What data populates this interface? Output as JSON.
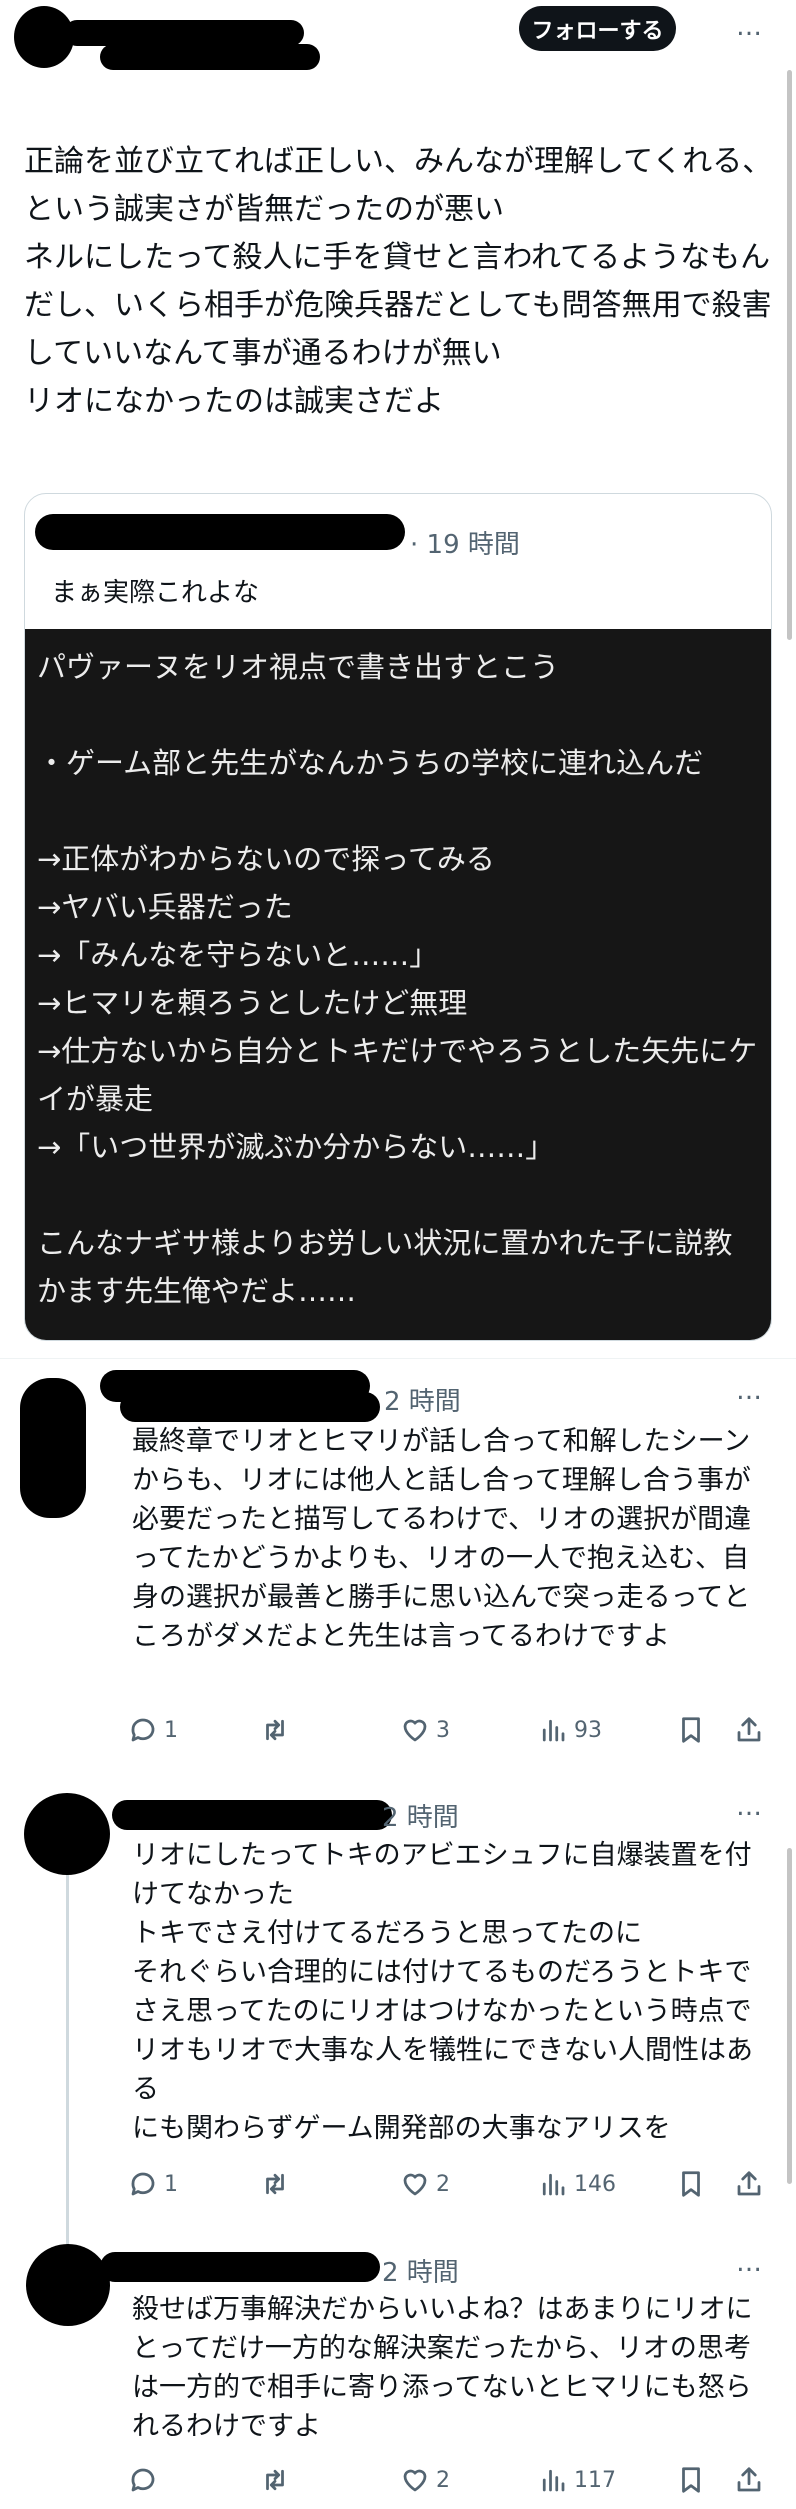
{
  "header": {
    "follow_label": "フォローする",
    "more_icon": "…"
  },
  "main_post": {
    "paragraphs": [
      "正論を並び立てれば正しい、みんなが理解してくれる、という誠実さが皆無だったのが悪い",
      "ネルにしたって殺人に手を貸せと言われてるようなもんだし、いくら相手が危険兵器だとしても問答無用で殺害していいなんて事が通るわけが無い",
      "リオになかったのは誠実さだよ"
    ]
  },
  "quote": {
    "time": "· 19 時間",
    "text": "まぁ実際これよな",
    "image_lines": [
      "パヴァーヌをリオ視点で書き出すとこう",
      "",
      "・ゲーム部と先生がなんかうちの学校に連れ込んだ",
      "→正体がわからないので探ってみる",
      "→ヤバい兵器だった",
      "→「みんなを守らないと……」",
      "→ヒマリを頼ろうとしたけど無理",
      "→仕方ないから自分とトキだけでやろうとした矢先にケイが暴走",
      "→「いつ世界が滅ぶか分からない……」",
      "",
      "こんなナギサ様よりお労しい状況に置かれた子に説教かます先生俺やだよ……"
    ]
  },
  "replies": [
    {
      "time": "2 時間",
      "text": "最終章でリオとヒマリが話し合って和解したシーンからも、リオには他人と話し合って理解し合う事が必要だったと描写してるわけで、リオの選択が間違ってたかどうかよりも、リオの一人で抱え込む、自身の選択が最善と勝手に思い込んで突っ走るってところがダメだよと先生は言ってるわけですよ",
      "replies": "1",
      "reposts": "",
      "likes": "3",
      "views": "93"
    },
    {
      "time": "2 時間",
      "text": "リオにしたってトキのアビエシュフに自爆装置を付けてなかった\nトキでさえ付けてるだろうと思ってたのに\nそれぐらい合理的には付けてるものだろうとトキでさえ思ってたのにリオはつけなかったという時点でリオもリオで大事な人を犠牲にできない人間性はある\nにも関わらずゲーム開発部の大事なアリスを",
      "replies": "1",
      "reposts": "",
      "likes": "2",
      "views": "146"
    },
    {
      "time": "2 時間",
      "text": "殺せば万事解決だからいいよね？はあまりにリオにとってだけ一方的な解決案だったから、リオの思考は一方的で相手に寄り添ってないとヒマリにも怒られるわけですよ",
      "replies": "",
      "reposts": "",
      "likes": "2",
      "views": "117"
    }
  ]
}
